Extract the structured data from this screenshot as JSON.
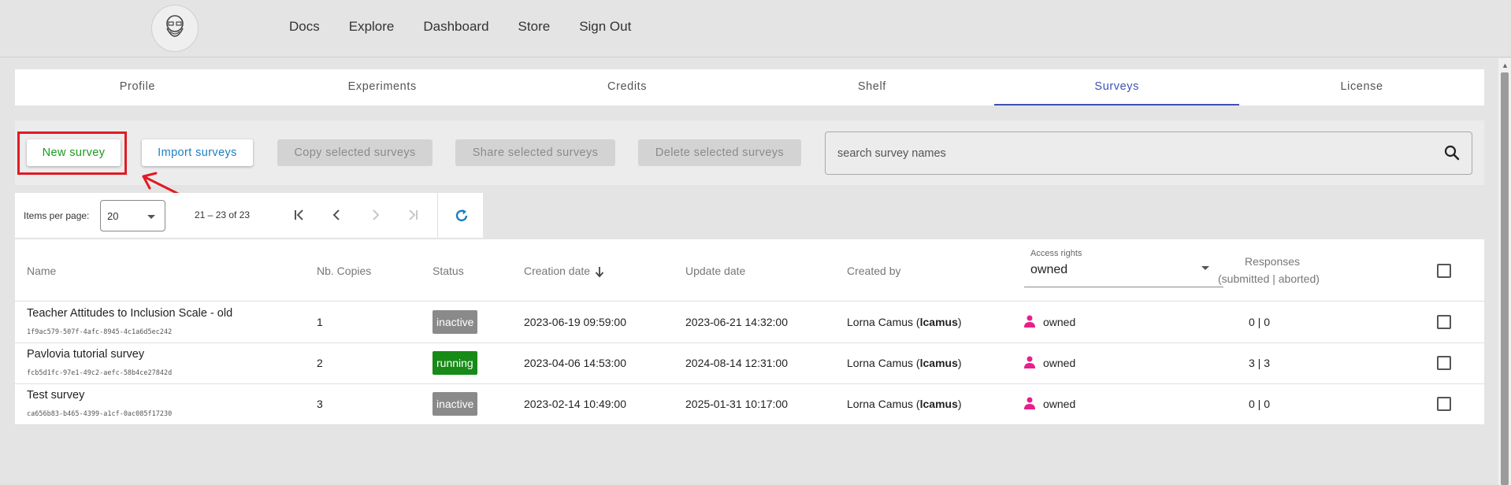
{
  "nav": {
    "items": [
      "Docs",
      "Explore",
      "Dashboard",
      "Store",
      "Sign Out"
    ]
  },
  "tabs": [
    "Profile",
    "Experiments",
    "Credits",
    "Shelf",
    "Surveys",
    "License"
  ],
  "active_tab": "Surveys",
  "toolbar": {
    "new_survey": "New survey",
    "import_surveys": "Import surveys",
    "copy_selected": "Copy selected surveys",
    "share_selected": "Share selected surveys",
    "delete_selected": "Delete selected surveys",
    "search_placeholder": "search survey names"
  },
  "paginator": {
    "items_per_page_label": "Items per page:",
    "items_per_page_value": "20",
    "range": "21 – 23 of 23"
  },
  "table": {
    "headers": {
      "name": "Name",
      "nb_copies": "Nb. Copies",
      "status": "Status",
      "creation_date": "Creation date",
      "update_date": "Update date",
      "created_by": "Created by",
      "access_rights_label": "Access rights",
      "access_rights_value": "owned",
      "responses_line1": "Responses",
      "responses_line2": "(submitted | aborted)"
    },
    "rows": [
      {
        "name": "Teacher Attitudes to Inclusion Scale - old",
        "id": "1f9ac579-507f-4afc-8945-4c1a6d5ec242",
        "copies": "1",
        "status": "inactive",
        "created": "2023-06-19 09:59:00",
        "updated": "2023-06-21 14:32:00",
        "creator": "Lorna Camus",
        "creator_handle": "lcamus",
        "access": "owned",
        "responses": "0 | 0"
      },
      {
        "name": "Pavlovia tutorial survey",
        "id": "fcb5d1fc-97e1-49c2-aefc-58b4ce27842d",
        "copies": "2",
        "status": "running",
        "created": "2023-04-06 14:53:00",
        "updated": "2024-08-14 12:31:00",
        "creator": "Lorna Camus",
        "creator_handle": "lcamus",
        "access": "owned",
        "responses": "3 | 3"
      },
      {
        "name": "Test survey",
        "id": "ca656b83-b465-4399-a1cf-0ac085f17230",
        "copies": "3",
        "status": "inactive",
        "created": "2023-02-14 10:49:00",
        "updated": "2025-01-31 10:17:00",
        "creator": "Lorna Camus",
        "creator_handle": "lcamus",
        "access": "owned",
        "responses": "0 | 0"
      }
    ]
  },
  "colors": {
    "accent": "#3f51b5",
    "running": "#178a17",
    "inactive": "#8a8a8a",
    "highlight": "#e01b24",
    "owner_icon": "#e91e8c",
    "new_btn_text": "#1a9a1a",
    "import_btn_text": "#1a7fc1"
  }
}
